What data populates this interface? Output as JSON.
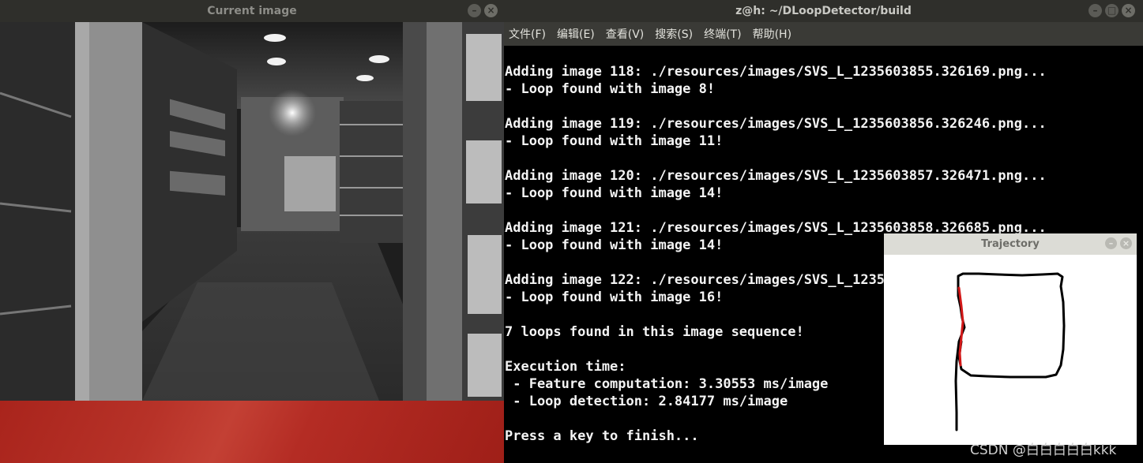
{
  "image_window": {
    "title": "Current image"
  },
  "terminal_window": {
    "title": "z@h: ~/DLoopDetector/build",
    "menu": [
      "文件(F)",
      "编辑(E)",
      "查看(V)",
      "搜索(S)",
      "终端(T)",
      "帮助(H)"
    ],
    "lines": [
      "Adding image 118: ./resources/images/SVS_L_1235603855.326169.png...",
      "- Loop found with image 8!",
      "",
      "Adding image 119: ./resources/images/SVS_L_1235603856.326246.png...",
      "- Loop found with image 11!",
      "",
      "Adding image 120: ./resources/images/SVS_L_1235603857.326471.png...",
      "- Loop found with image 14!",
      "",
      "Adding image 121: ./resources/images/SVS_L_1235603858.326685.png...",
      "- Loop found with image 14!",
      "",
      "Adding image 122: ./resources/images/SVS_L_12356",
      "- Loop found with image 16!",
      "",
      "7 loops found in this image sequence!",
      "",
      "Execution time:",
      " - Feature computation: 3.30553 ms/image",
      " - Loop detection: 2.84177 ms/image",
      "",
      "Press a key to finish..."
    ]
  },
  "trajectory_window": {
    "title": "Trajectory",
    "path_color": "#000000",
    "loop_color": "#d21818"
  },
  "watermark": "CSDN @白白白白白kkk",
  "colors": {
    "titlebar": "#2f2f2b",
    "terminal_bg": "#000000",
    "wallpaper": "#b02a22"
  }
}
